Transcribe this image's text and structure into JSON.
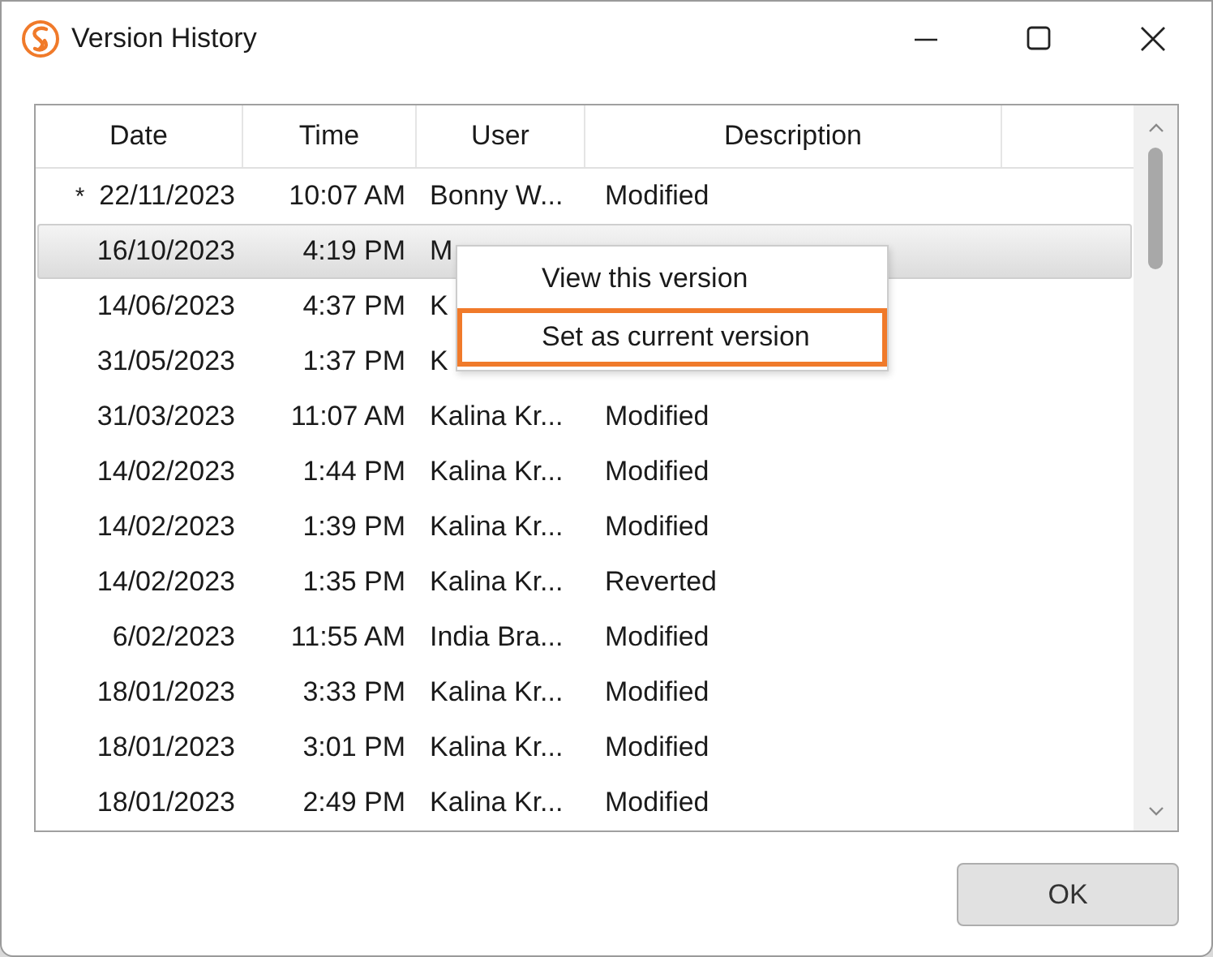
{
  "window": {
    "title": "Version History"
  },
  "table": {
    "columns": [
      "Date",
      "Time",
      "User",
      "Description"
    ],
    "rows": [
      {
        "marker": "*",
        "date": "22/11/2023",
        "time": "10:07 AM",
        "user": "Bonny W...",
        "description": "Modified",
        "selected": false
      },
      {
        "date": "16/10/2023",
        "time": "4:19 PM",
        "user": "M",
        "selected": true
      },
      {
        "date": "14/06/2023",
        "time": "4:37 PM",
        "user": "K",
        "selected": false
      },
      {
        "date": "31/05/2023",
        "time": "1:37 PM",
        "user": "K",
        "selected": false
      },
      {
        "date": "31/03/2023",
        "time": "11:07 AM",
        "user": "Kalina Kr...",
        "description": "Modified",
        "selected": false
      },
      {
        "date": "14/02/2023",
        "time": "1:44 PM",
        "user": "Kalina Kr...",
        "description": "Modified",
        "selected": false
      },
      {
        "date": "14/02/2023",
        "time": "1:39 PM",
        "user": "Kalina Kr...",
        "description": "Modified",
        "selected": false
      },
      {
        "date": "14/02/2023",
        "time": "1:35 PM",
        "user": "Kalina Kr...",
        "description": "Reverted",
        "selected": false
      },
      {
        "date": "6/02/2023",
        "time": "11:55 AM",
        "user": "India Bra...",
        "description": "Modified",
        "selected": false
      },
      {
        "date": "18/01/2023",
        "time": "3:33 PM",
        "user": "Kalina Kr...",
        "description": "Modified",
        "selected": false
      },
      {
        "date": "18/01/2023",
        "time": "3:01 PM",
        "user": "Kalina Kr...",
        "description": "Modified",
        "selected": false
      },
      {
        "date": "18/01/2023",
        "time": "2:49 PM",
        "user": "Kalina Kr...",
        "description": "Modified",
        "selected": false
      }
    ]
  },
  "context_menu": {
    "items": [
      {
        "label": "View this version",
        "selected": false
      },
      {
        "label": "Set as current version",
        "selected": true
      }
    ]
  },
  "buttons": [
    "OK"
  ]
}
